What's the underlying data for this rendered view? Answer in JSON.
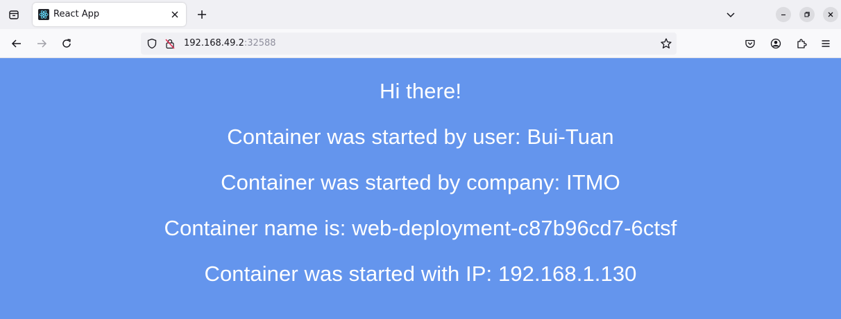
{
  "browser": {
    "tab": {
      "title": "React App",
      "favicon": "react-logo-icon"
    },
    "url": {
      "host": "192.168.49.2",
      "port": ":32588"
    },
    "icons": {
      "tabs_list": "tabs-list-icon",
      "close_tab": "close-icon",
      "new_tab": "plus-icon",
      "all_tabs": "chevron-down-icon",
      "back": "back-arrow-icon",
      "forward": "forward-arrow-icon",
      "reload": "reload-icon",
      "tracking_protection": "shield-icon",
      "insecure": "insecure-lock-icon",
      "bookmark": "star-icon",
      "pocket": "pocket-icon",
      "account": "account-icon",
      "extensions": "extensions-icon",
      "menu": "hamburger-menu-icon"
    }
  },
  "page": {
    "background": "#6495ED",
    "greeting": "Hi there!",
    "user_line": "Container was started by user: Bui-Tuan",
    "company_line": "Container was started by company: ITMO",
    "name_line": "Container name is: web-deployment-c87b96cd7-6ctsf",
    "ip_line": "Container was started with IP: 192.168.1.130"
  }
}
